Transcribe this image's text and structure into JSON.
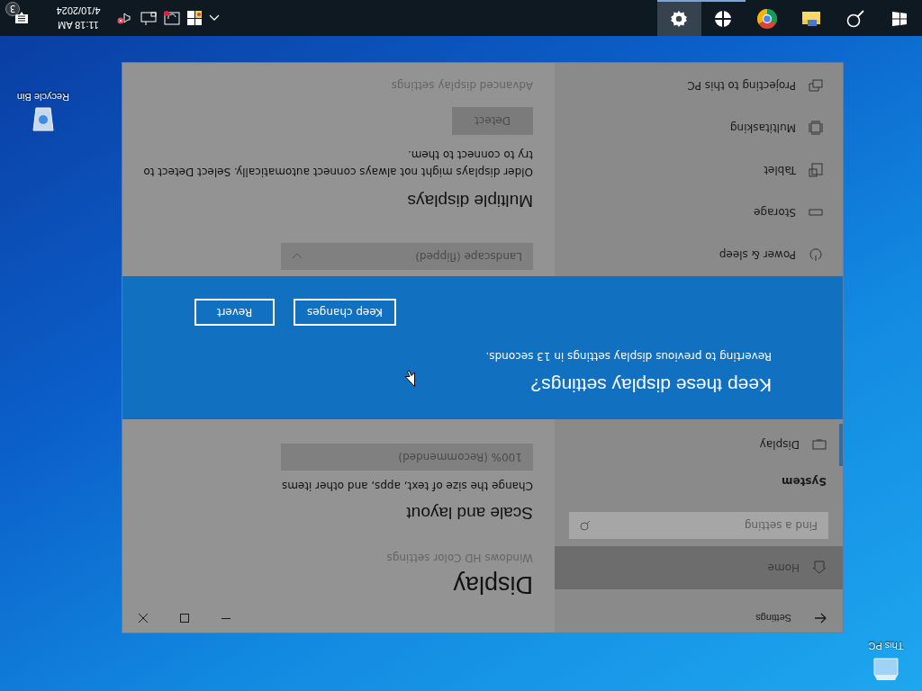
{
  "desktop_icons": [
    {
      "kind": "pc",
      "label": "This PC"
    },
    {
      "kind": "bin",
      "label": "Recycle Bin"
    }
  ],
  "settings_window": {
    "title": "Settings",
    "sidebar": {
      "home": {
        "label": "Home"
      },
      "search": {
        "placeholder": "Find a setting"
      },
      "section": "System",
      "nav": [
        {
          "kind": "display",
          "label": "Display",
          "selected": true
        }
      ],
      "nav_continued": [
        {
          "kind": "power",
          "label": "Power & sleep",
          "selected": false
        },
        {
          "kind": "storage",
          "label": "Storage",
          "selected": false
        },
        {
          "kind": "tablet",
          "label": "Tablet",
          "selected": false
        },
        {
          "kind": "multitasking",
          "label": "Multitasking",
          "selected": false
        },
        {
          "kind": "projecting",
          "label": "Projecting to this PC",
          "selected": false
        }
      ]
    },
    "content": {
      "title": "Display",
      "hd_link": "Windows HD Color settings",
      "scale_heading": "Scale and layout",
      "scale_text": "Change the size of text, apps, and other items",
      "scale_dropdown": "100% (Recommended)",
      "orientation_dropdown": "Landscape (flipped)",
      "multi_heading": "Multiple displays",
      "multi_text": "Older displays might not always connect automatically. Select Detect to try to connect to them.",
      "detect_button": "Detect",
      "advanced_link": "Advanced display settings"
    },
    "dialog": {
      "title": "Keep these display settings?",
      "message": "Reverting to previous display settings in 13 seconds.",
      "buttons": [
        "Keep changes",
        "Revert"
      ]
    }
  },
  "taskbar": {
    "apps": [
      {
        "kind": "start",
        "running": false,
        "selected": false
      },
      {
        "kind": "search",
        "running": false,
        "selected": false
      },
      {
        "kind": "explorer",
        "running": false,
        "selected": false
      },
      {
        "kind": "chrome",
        "running": false,
        "selected": false
      },
      {
        "kind": "tiles",
        "running": true,
        "selected": false
      },
      {
        "kind": "settings",
        "running": true,
        "selected": true
      }
    ],
    "tray": {
      "icons": [
        {
          "kind": "chevron"
        },
        {
          "kind": "security"
        },
        {
          "kind": "sync"
        },
        {
          "kind": "network"
        },
        {
          "kind": "volume"
        }
      ],
      "time": "11:18 AM",
      "date": "4/10/2024",
      "notification_count": "3"
    }
  }
}
